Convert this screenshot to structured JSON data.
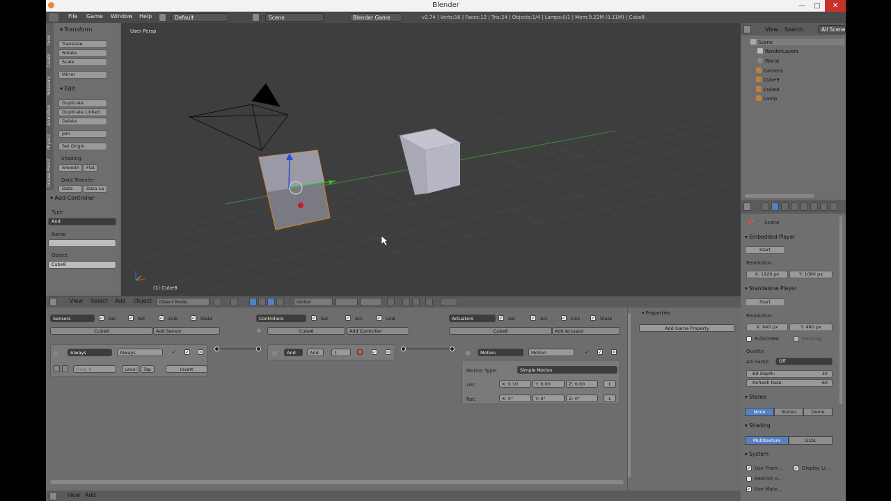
{
  "window": {
    "title": "Blender",
    "minimize": "—",
    "maximize": "□",
    "close": "✕"
  },
  "infobar": {
    "menus": [
      "File",
      "Game",
      "Window",
      "Help"
    ],
    "layout": "Default",
    "scene": "Scene",
    "engine": "Blender Game",
    "stats": "v2.74 | Verts:16 | Faces:12 | Tris:24 | Objects:1/4 | Lamps:0/1 | Mem:9.22M (0.11M) | Cube8"
  },
  "toolshelf": {
    "tabs": [
      "Tools",
      "Create",
      "Relations",
      "Animation",
      "Physics",
      "Grease Pencil"
    ],
    "transform_header": "▾ Transform",
    "transform": [
      "Translate",
      "Rotate",
      "Scale",
      "Mirror"
    ],
    "edit_header": "▾ Edit",
    "edit": [
      "Duplicate",
      "Duplicate Linked",
      "Delete",
      "Join"
    ],
    "set_origin": "Set Origin",
    "shading_label": "Shading:",
    "smooth": "Smooth",
    "flat": "Flat",
    "data_transfer_label": "Data Transfer:",
    "data": "Data",
    "data_layers": "Data La",
    "add_controller_header": "▾ Add Controller",
    "type_label": "Type",
    "type_value": "And",
    "name_label": "Name",
    "name_value": "",
    "object_label": "Object",
    "object_value": "Cube8"
  },
  "viewport": {
    "label": "User Persp",
    "object": "(1) Cube8"
  },
  "viewport_header": {
    "view": "View",
    "select": "Select",
    "add": "Add",
    "object": "Object",
    "mode": "Object Mode",
    "orientation": "Global"
  },
  "logic": {
    "sensors": {
      "title": "Sensors",
      "sel": "Sel",
      "act": "Act",
      "link": "Link",
      "state": "State",
      "object": "Cube8",
      "add": "Add Sensor",
      "brick_type": "Always",
      "brick_name": "Always",
      "freq": "Freq:",
      "freq_val": "0",
      "level": "Level",
      "tap": "Tap",
      "invert": "Invert"
    },
    "controllers": {
      "title": "Controllers",
      "sel": "Sel",
      "act": "Act",
      "link": "Link",
      "object": "Cube8",
      "add": "Add Controller",
      "brick_type": "And",
      "brick_name": "And",
      "state": "1"
    },
    "actuators": {
      "title": "Actuators",
      "sel": "Sel",
      "act": "Act",
      "link": "Link",
      "state": "State",
      "object": "Cube8",
      "add": "Add Actuator",
      "brick_type": "Motion",
      "brick_name": "Motion",
      "motion_type_label": "Motion Type:",
      "motion_type": "Simple Motion",
      "loc_label": "Loc:",
      "loc": [
        "X: 0.10",
        "Y: 0.00",
        "Z: 0.00"
      ],
      "rot_label": "Rot:",
      "rot": [
        "X: 0°",
        "Y: 0°",
        "Z: 0°"
      ],
      "local": "L"
    },
    "properties": {
      "title": "▾ Properties",
      "add": "Add Game Property"
    }
  },
  "logic_footer": {
    "view": "View",
    "add": "Add"
  },
  "outliner": {
    "view": "View",
    "search": "Search",
    "scope": "All Scenes",
    "items": [
      "Scene",
      "RenderLayers",
      "World",
      "Camera",
      "Cube9",
      "Cube8",
      "Lamp"
    ]
  },
  "properties": {
    "context": "Scene",
    "embedded_header": "▾ Embedded Player",
    "start": "Start",
    "resolution_label": "Resolution:",
    "emb_res_x": "X:  1920 px",
    "emb_res_y": "Y:  1080 px",
    "standalone_header": "▾ Standalone Player",
    "sa_res_x": "X:  640 px",
    "sa_res_y": "Y:  480 px",
    "fullscreen": "Fullscreen",
    "desktop": "Desktop",
    "quality_label": "Quality:",
    "aa_label": "AA Samp",
    "aa_value": "Off",
    "bit_depth": "Bit Depth:",
    "bit_depth_val": "32",
    "refresh": "Refresh Rate:",
    "refresh_val": "60",
    "stereo_header": "▾ Stereo",
    "stereo": [
      "None",
      "Stereo",
      "Dome"
    ],
    "shading_header": "▾ Shading",
    "shading": [
      "Multitexture",
      "GLSL"
    ],
    "system_header": "▾ System",
    "use_frame": "Use Fram...",
    "display_lists": "Display Li...",
    "restrict": "Restrict A...",
    "use_mate": "Use Mate..."
  },
  "colors": {
    "accent": "#5680c2",
    "viewport": "#3e3e3e",
    "panel": "#727272"
  }
}
